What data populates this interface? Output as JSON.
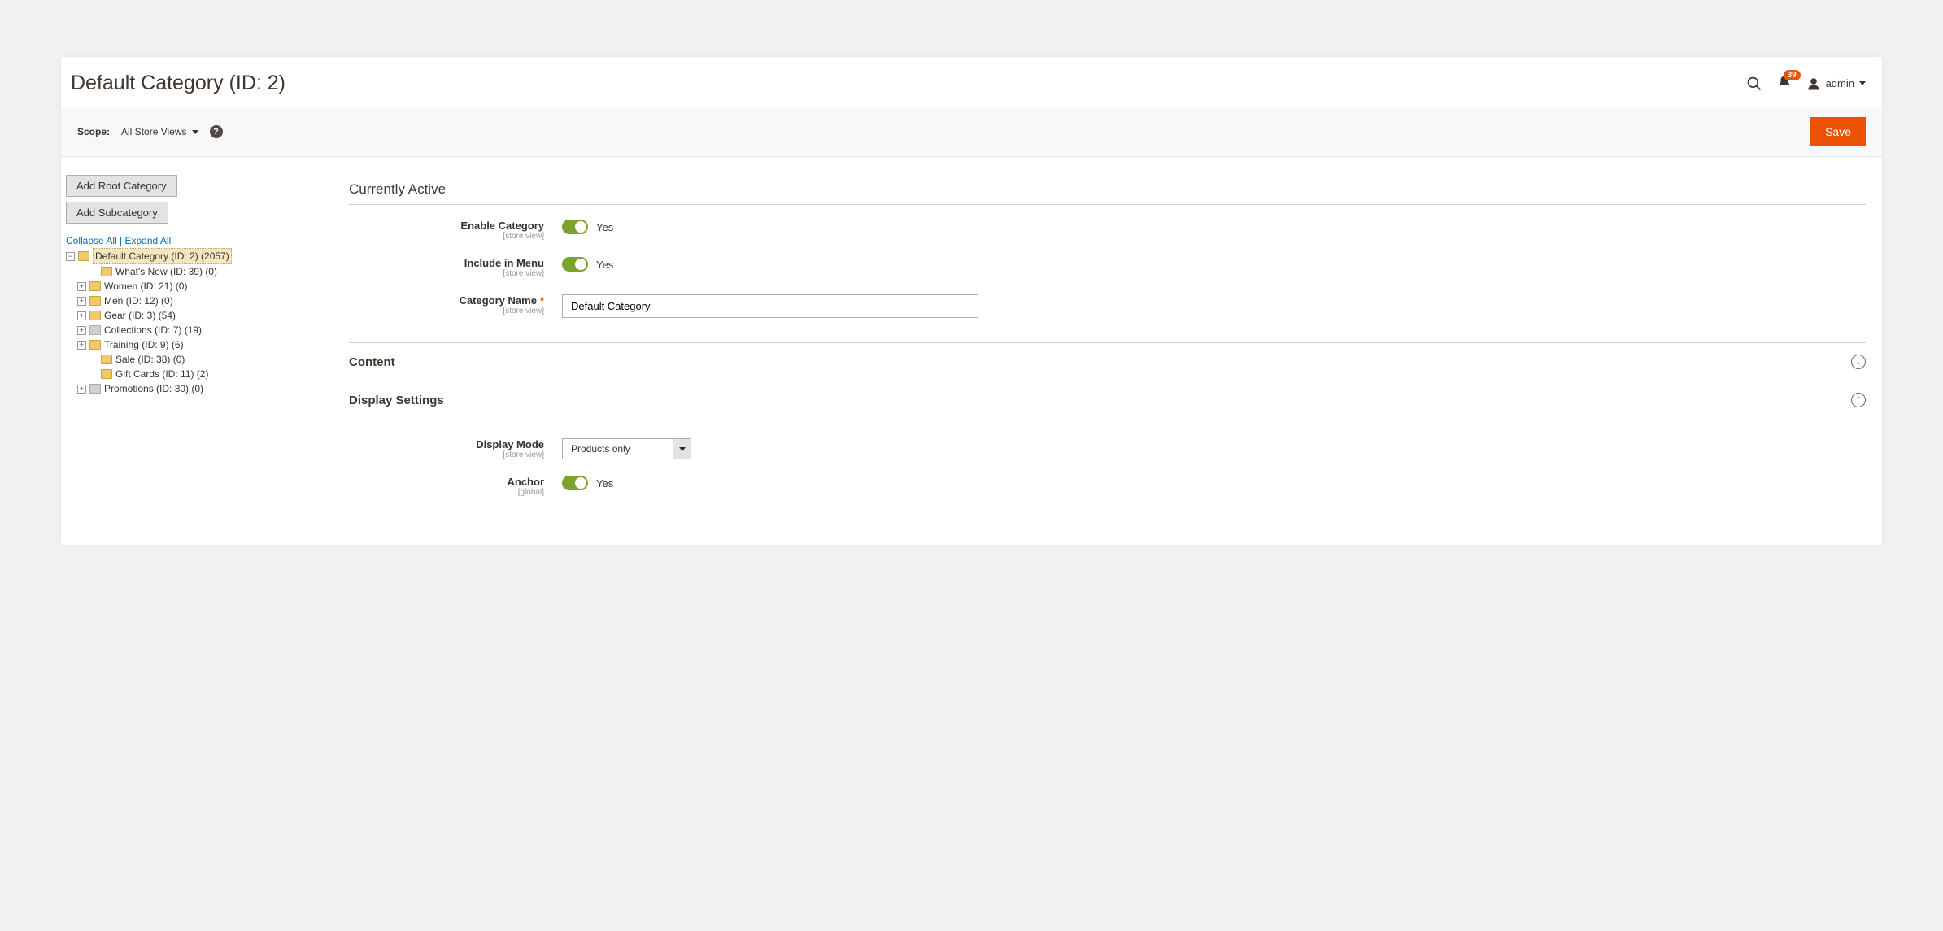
{
  "header": {
    "title": "Default Category (ID: 2)",
    "notification_count": "39",
    "user_name": "admin"
  },
  "scope_bar": {
    "label": "Scope:",
    "selected": "All Store Views",
    "save_label": "Save"
  },
  "sidebar": {
    "add_root_label": "Add Root Category",
    "add_sub_label": "Add Subcategory",
    "collapse_label": "Collapse All",
    "expand_label": "Expand All",
    "tree": {
      "root": "Default Category (ID: 2) (2057)",
      "n_whats_new": "What's New (ID: 39) (0)",
      "n_women": "Women (ID: 21) (0)",
      "n_men": "Men (ID: 12) (0)",
      "n_gear": "Gear (ID: 3) (54)",
      "n_collections": "Collections (ID: 7) (19)",
      "n_training": "Training (ID: 9) (6)",
      "n_sale": "Sale (ID: 38) (0)",
      "n_gift": "Gift Cards (ID: 11) (2)",
      "n_promotions": "Promotions (ID: 30) (0)"
    }
  },
  "form": {
    "section_active": "Currently Active",
    "enable_label": "Enable Category",
    "enable_hint": "[store view]",
    "enable_value": "Yes",
    "menu_label": "Include in Menu",
    "menu_hint": "[store view]",
    "menu_value": "Yes",
    "name_label": "Category Name",
    "name_hint": "[store view]",
    "name_value": "Default Category",
    "section_content": "Content",
    "section_display": "Display Settings",
    "display_mode_label": "Display Mode",
    "display_mode_hint": "[store view]",
    "display_mode_value": "Products only",
    "anchor_label": "Anchor",
    "anchor_hint": "[global]",
    "anchor_value": "Yes"
  }
}
